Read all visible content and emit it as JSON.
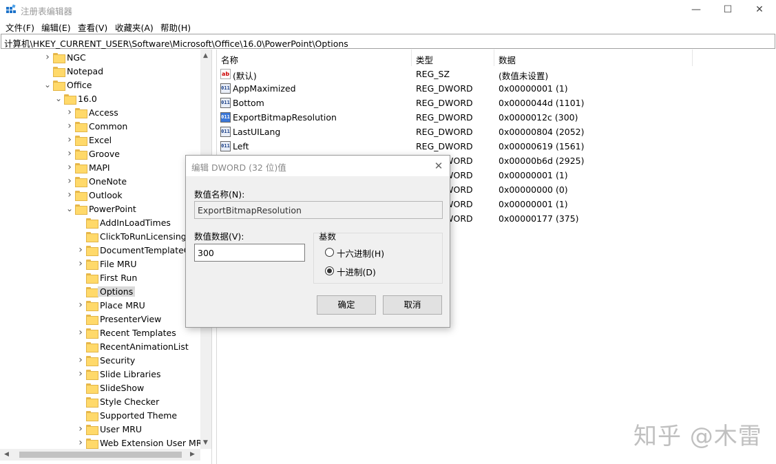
{
  "window": {
    "title": "注册表编辑器",
    "controls": {
      "minimize": "—",
      "maximize": "☐",
      "close": "✕"
    }
  },
  "menu": [
    "文件(F)",
    "编辑(E)",
    "查看(V)",
    "收藏夹(A)",
    "帮助(H)"
  ],
  "address": "计算机\\HKEY_CURRENT_USER\\Software\\Microsoft\\Office\\16.0\\PowerPoint\\Options",
  "tree": {
    "items": [
      {
        "label": "NGC",
        "expander": "collapsed"
      },
      {
        "label": "Notepad",
        "expander": "none"
      },
      {
        "label": "Office",
        "expander": "expanded"
      },
      {
        "label": "16.0",
        "expander": "expanded"
      },
      {
        "label": "Access",
        "expander": "collapsed"
      },
      {
        "label": "Common",
        "expander": "collapsed"
      },
      {
        "label": "Excel",
        "expander": "collapsed"
      },
      {
        "label": "Groove",
        "expander": "collapsed"
      },
      {
        "label": "MAPI",
        "expander": "collapsed"
      },
      {
        "label": "OneNote",
        "expander": "collapsed"
      },
      {
        "label": "Outlook",
        "expander": "collapsed"
      },
      {
        "label": "PowerPoint",
        "expander": "expanded"
      },
      {
        "label": "AddInLoadTimes",
        "expander": "none"
      },
      {
        "label": "ClickToRunLicensing",
        "expander": "none"
      },
      {
        "label": "DocumentTemplateCa",
        "expander": "collapsed"
      },
      {
        "label": "File MRU",
        "expander": "collapsed"
      },
      {
        "label": "First Run",
        "expander": "none"
      },
      {
        "label": "Options",
        "expander": "none",
        "selected": true
      },
      {
        "label": "Place MRU",
        "expander": "collapsed"
      },
      {
        "label": "PresenterView",
        "expander": "none"
      },
      {
        "label": "Recent Templates",
        "expander": "collapsed"
      },
      {
        "label": "RecentAnimationList",
        "expander": "none"
      },
      {
        "label": "Security",
        "expander": "collapsed"
      },
      {
        "label": "Slide Libraries",
        "expander": "collapsed"
      },
      {
        "label": "SlideShow",
        "expander": "none"
      },
      {
        "label": "Style Checker",
        "expander": "none"
      },
      {
        "label": "Supported Theme",
        "expander": "none"
      },
      {
        "label": "User MRU",
        "expander": "collapsed"
      },
      {
        "label": "Web Extension User MRU",
        "expander": "collapsed"
      }
    ]
  },
  "list": {
    "headers": {
      "name": "名称",
      "type": "类型",
      "data": "数据"
    },
    "rows": [
      {
        "icon": "string-value-icon",
        "name": "(默认)",
        "type": "REG_SZ",
        "data": "(数值未设置)"
      },
      {
        "icon": "binary-value-icon",
        "name": "AppMaximized",
        "type": "REG_DWORD",
        "data": "0x00000001 (1)"
      },
      {
        "icon": "binary-value-icon",
        "name": "Bottom",
        "type": "REG_DWORD",
        "data": "0x0000044d (1101)"
      },
      {
        "icon": "binary-value-icon",
        "name": "ExportBitmapResolution",
        "type": "REG_DWORD",
        "data": "0x0000012c (300)",
        "highlight_icon": true
      },
      {
        "icon": "binary-value-icon",
        "name": "LastUILang",
        "type": "REG_DWORD",
        "data": "0x00000804 (2052)"
      },
      {
        "icon": "binary-value-icon",
        "name": "Left",
        "type": "REG_DWORD",
        "data": "0x00000619 (1561)"
      },
      {
        "icon": "binary-value-icon",
        "name": "",
        "type": "REG_DWORD",
        "data": "0x00000b6d (2925)"
      },
      {
        "icon": "binary-value-icon",
        "name": "",
        "type": "REG_DWORD",
        "data": "0x00000001 (1)"
      },
      {
        "icon": "binary-value-icon",
        "name": "",
        "type": "REG_DWORD",
        "data": "0x00000000 (0)"
      },
      {
        "icon": "binary-value-icon",
        "name": "",
        "type": "REG_DWORD",
        "data": "0x00000001 (1)"
      },
      {
        "icon": "binary-value-icon",
        "name": "",
        "type": "REG_DWORD",
        "data": "0x00000177 (375)"
      }
    ]
  },
  "dialog": {
    "title": "编辑 DWORD (32 位)值",
    "name_label": "数值名称(N):",
    "name_value": "ExportBitmapResolution",
    "data_label": "数值数据(V):",
    "data_value": "300",
    "base_label": "基数",
    "radio_hex": "十六进制(H)",
    "radio_dec": "十进制(D)",
    "selected_base": "dec",
    "ok": "确定",
    "cancel": "取消"
  },
  "watermark": "知乎 @木雷"
}
